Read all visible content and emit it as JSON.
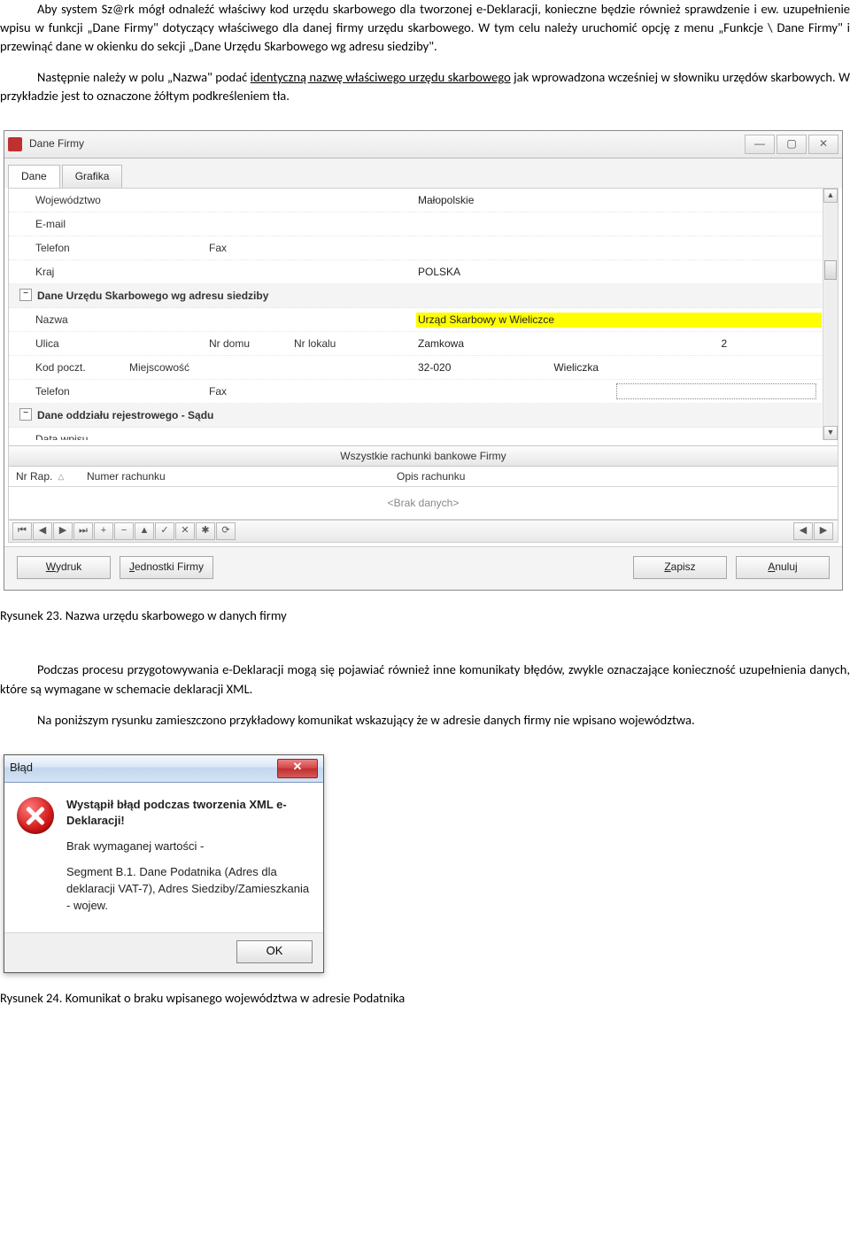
{
  "doc": {
    "p1": "Aby system Sz@rk mógł odnaleźć właściwy kod urzędu skarbowego dla tworzonej e-Deklaracji, konieczne będzie również sprawdzenie i ew. uzupełnienie wpisu w funkcji „Dane Firmy\" dotyczący właściwego dla danej firmy urzędu skarbowego. W tym celu należy uruchomić opcję z menu „Funkcje \\ Dane Firmy\" i przewinąć dane w okienku do sekcji „Dane Urzędu Skarbowego wg adresu siedziby\".",
    "p2_a": "Następnie należy w polu „Nazwa\" podać ",
    "p2_u": "identyczną nazwę właściwego urzędu skarbowego",
    "p2_b": " jak wprowadzona wcześniej w słowniku urzędów skarbowych. W przykładzie jest to oznaczone żółtym podkreśleniem tła.",
    "cap1": "Rysunek 23. Nazwa urzędu skarbowego w danych firmy",
    "p3": "Podczas procesu przygotowywania e-Deklaracji mogą się pojawiać również inne komunikaty błędów, zwykle oznaczające konieczność uzupełnienia danych, które są wymagane w schemacie deklaracji XML.",
    "p4": "Na poniższym rysunku zamieszczono przykładowy komunikat wskazujący że w adresie danych firmy nie wpisano województwa.",
    "cap2": "Rysunek 24. Komunikat o braku wpisanego województwa w adresie Podatnika"
  },
  "win": {
    "title": "Dane Firmy",
    "tabs": {
      "dane": "Dane",
      "grafika": "Grafika"
    },
    "rows": {
      "woj_l": "Województwo",
      "woj_v": "Małopolskie",
      "email_l": "E-mail",
      "tel_l": "Telefon",
      "fax_l": "Fax",
      "kraj_l": "Kraj",
      "kraj_v": "POLSKA",
      "grp1": "Dane Urzędu Skarbowego wg adresu siedziby",
      "nazwa_l": "Nazwa",
      "nazwa_v": "Urząd Skarbowy w Wieliczce",
      "ulica_l": "Ulica",
      "nrdomu_l": "Nr domu",
      "nrlokalu_l": "Nr lokalu",
      "ulica_v": "Zamkowa",
      "nrdomu_v": "2",
      "kod_l": "Kod poczt.",
      "miejsc_l": "Miejscowość",
      "kod_v": "32-020",
      "miejsc_v": "Wieliczka",
      "grp2": "Dane oddziału rejestrowego - Sądu",
      "data_l": "Data wpisu"
    },
    "bank": {
      "header": "Wszystkie rachunki bankowe Firmy",
      "c1": "Nr Rap.",
      "c2": "Numer rachunku",
      "c3": "Opis rachunku",
      "empty": "<Brak danych>"
    },
    "buttons": {
      "wydruk": "Wydruk",
      "jednostki": "Jednostki Firmy",
      "zapisz": "Zapisz",
      "anuluj": "Anuluj"
    },
    "winbtns": {
      "min": "—",
      "max": "▢",
      "close": "✕"
    }
  },
  "dlg": {
    "title": "Błąd",
    "l1": "Wystąpił błąd podczas tworzenia XML e-Deklaracji!",
    "l2": "Brak wymaganej wartości -",
    "l3": "Segment B.1. Dane Podatnika (Adres dla deklaracji VAT-7), Adres Siedziby/Zamieszkania - wojew.",
    "ok": "OK"
  }
}
